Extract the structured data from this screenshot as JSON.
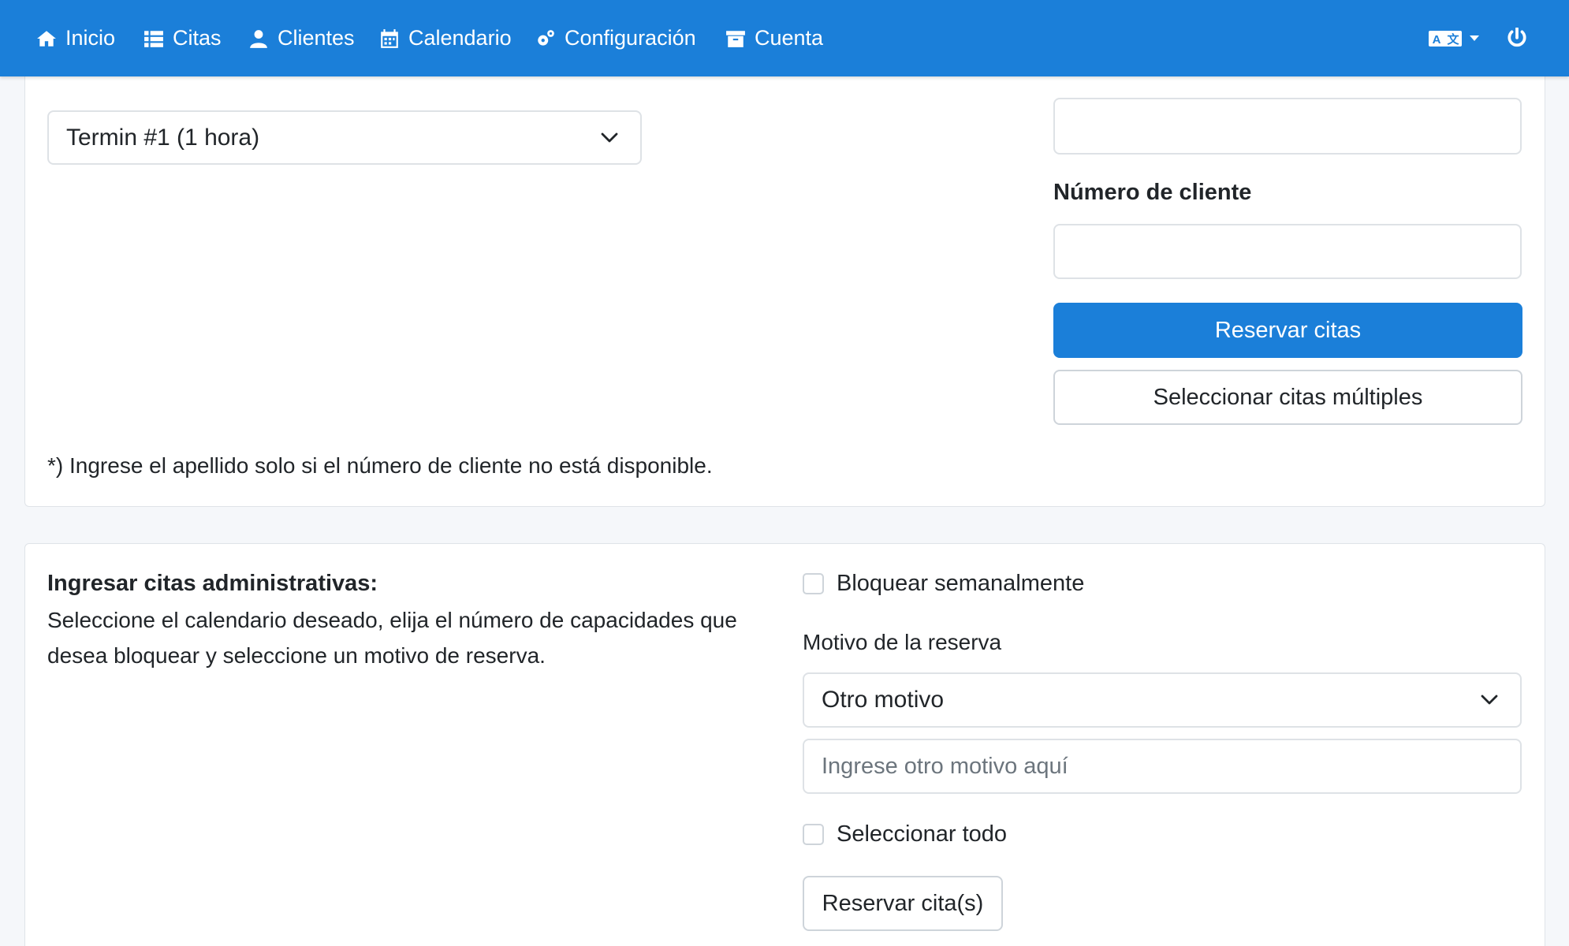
{
  "nav": {
    "items": [
      {
        "label": "Inicio",
        "icon": "home-icon"
      },
      {
        "label": "Citas",
        "icon": "list-icon"
      },
      {
        "label": "Clientes",
        "icon": "user-icon"
      },
      {
        "label": "Calendario",
        "icon": "calendar-icon"
      },
      {
        "label": "Configuración",
        "icon": "gears-icon"
      },
      {
        "label": "Cuenta",
        "icon": "archive-icon"
      }
    ],
    "language_icon": "language-icon",
    "power_icon": "power-icon"
  },
  "booking": {
    "appointment_select": "Termin #1 (1 hora)",
    "customer_number_label": "Número de cliente",
    "customer_number_value": "",
    "top_field_value": "",
    "reserve_button": "Reservar citas",
    "multi_button": "Seleccionar citas múltiples",
    "footnote": "*) Ingrese el apellido solo si el número de cliente no está disponible."
  },
  "admin": {
    "title": "Ingresar citas administrativas:",
    "description": "Seleccione el calendario deseado, elija el número de capacidades que desea bloquear y seleccione un motivo de reserva.",
    "block_weekly_label": "Bloquear semanalmente",
    "reason_label": "Motivo de la reserva",
    "reason_select": "Otro motivo",
    "other_reason_placeholder": "Ingrese otro motivo aquí",
    "select_all_label": "Seleccionar todo",
    "reserve_button": "Reservar cita(s)"
  },
  "colors": {
    "primary": "#1b7fd9",
    "background": "#f5f7fa"
  }
}
